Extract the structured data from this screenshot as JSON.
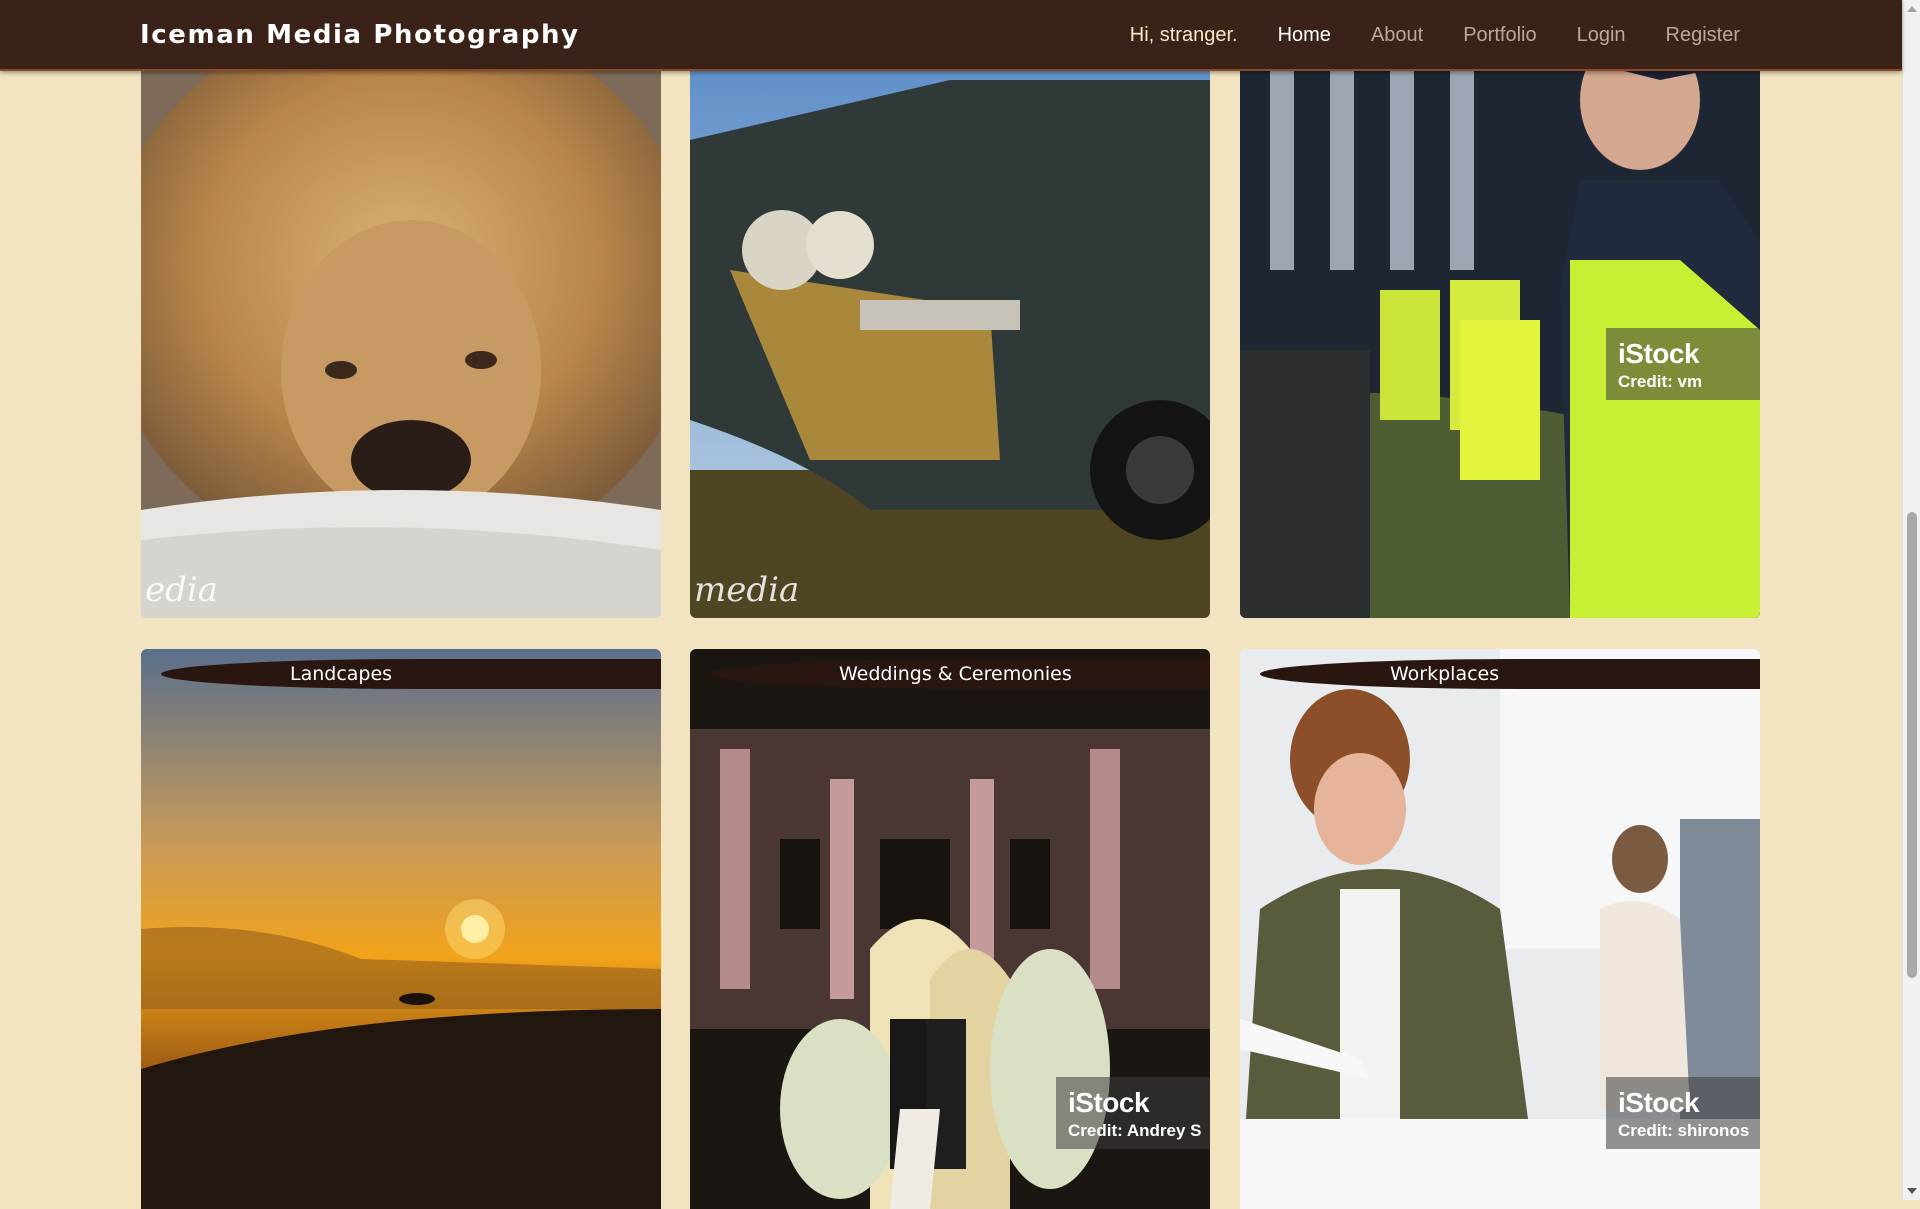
{
  "navbar": {
    "brand": "Iceman Media Photography",
    "greeting": "Hi, stranger.",
    "links": [
      "Home",
      "About",
      "Portfolio",
      "Login",
      "Register"
    ],
    "active": "Home"
  },
  "row1": [
    {
      "watermark": "edia"
    },
    {
      "watermark": "media"
    },
    {
      "istock_logo": "iStock",
      "istock_credit": "Credit: vm"
    }
  ],
  "row2": [
    {
      "title": "Landcapes"
    },
    {
      "title": "Weddings & Ceremonies",
      "istock_logo": "iStock",
      "istock_credit": "Credit: Andrey S"
    },
    {
      "title": "Workplaces",
      "istock_logo": "iStock",
      "istock_credit": "Credit: shironos"
    }
  ],
  "colors": {
    "background": "#f3e4c1",
    "navbar": "#3a2219",
    "band": "#2a1610"
  }
}
